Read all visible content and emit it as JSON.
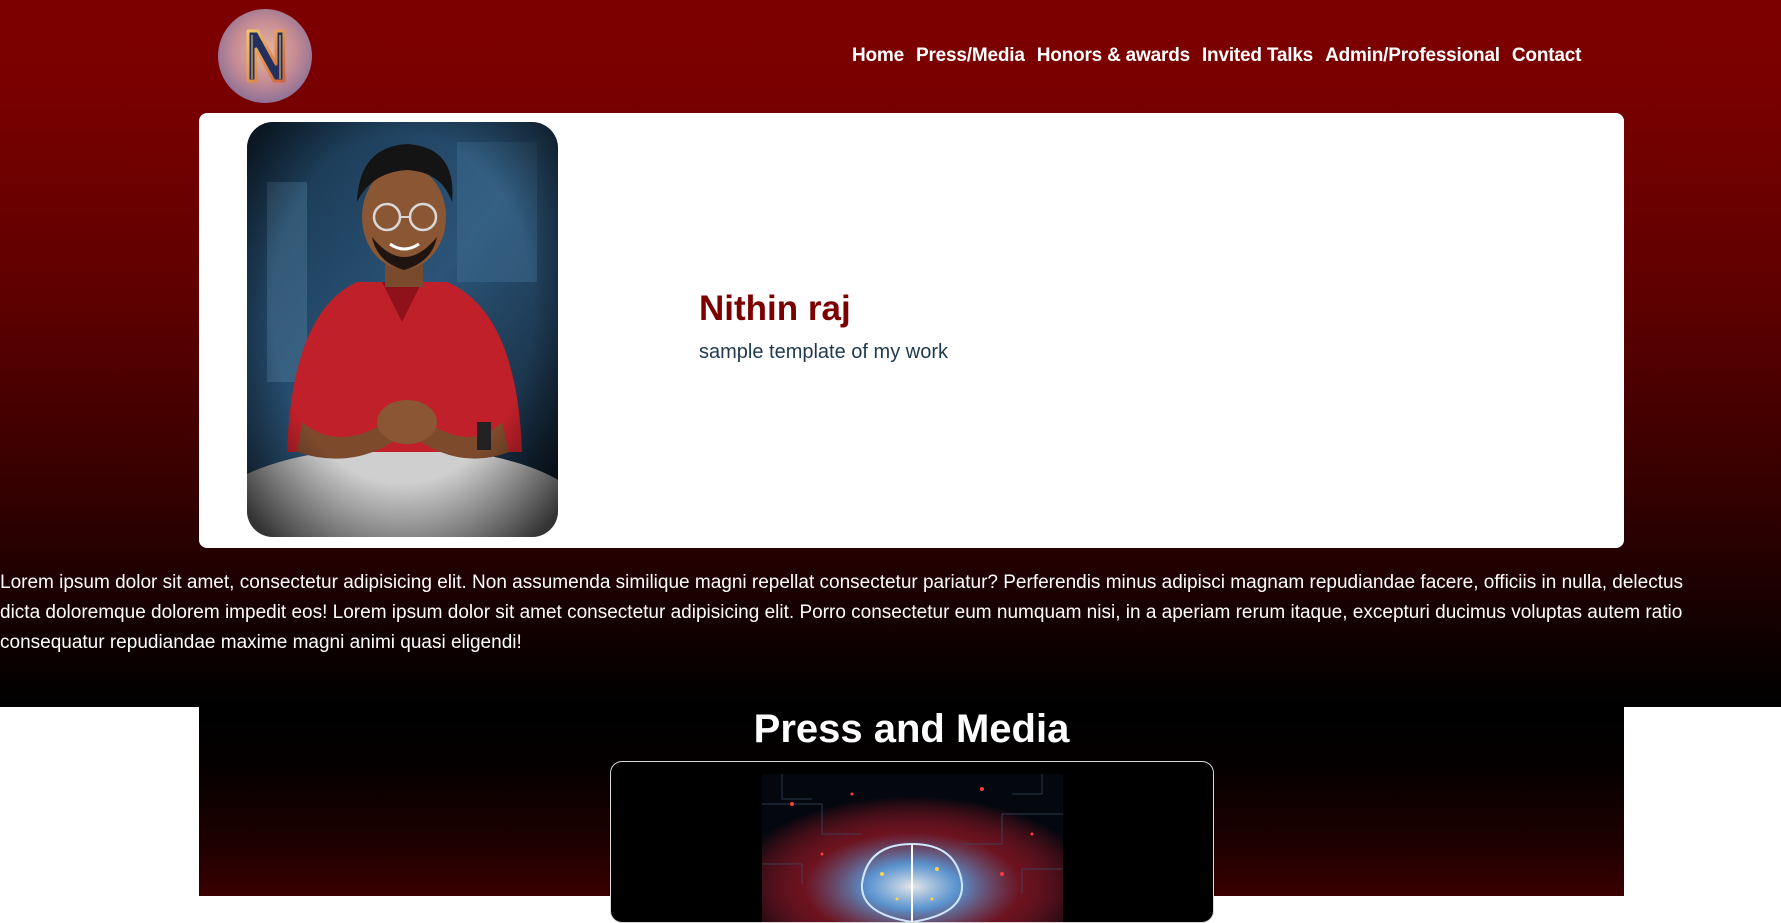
{
  "header": {
    "logo_icon": "letter-n-logo",
    "nav": [
      "Home",
      "Press/Media",
      "Honors & awards",
      "Invited Talks",
      "Admin/Professional",
      "Contact"
    ]
  },
  "hero": {
    "name": "Nithin raj",
    "subtitle": "sample template of my work"
  },
  "about": {
    "lines": [
      "Lorem ipsum dolor sit amet, consectetur adipisicing elit. Non assumenda similique magni repellat consectetur pariatur? Perferendis minus adipisci magnam repudiandae facere, officiis in nulla, delectus",
      "dicta doloremque dolorem impedit eos! Lorem ipsum dolor sit amet consectetur adipisicing elit. Porro consectetur eum numquam nisi, in a aperiam rerum itaque, excepturi ducimus voluptas autem ratio",
      "consequatur repudiandae maxime magni animi quasi eligendi!"
    ]
  },
  "press": {
    "title": "Press and Media"
  },
  "colors": {
    "brand": "#7d0000",
    "subtitle": "#1e3a4c",
    "background_dark": "#000000"
  }
}
